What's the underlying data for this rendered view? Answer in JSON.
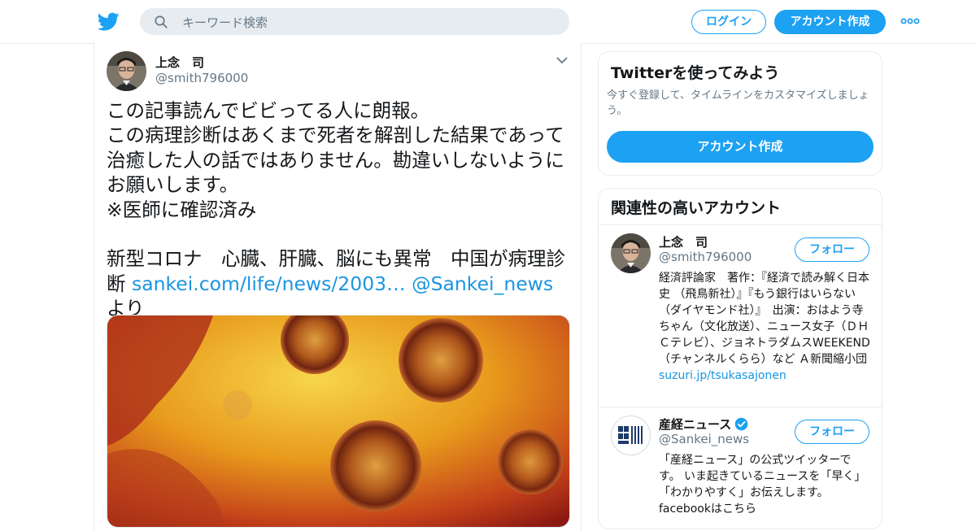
{
  "header": {
    "search_placeholder": "キーワード検索",
    "login_label": "ログイン",
    "signup_label": "アカウント作成",
    "brand_color": "#1da1f2",
    "icons": [
      "twitter-logo-icon",
      "search-icon",
      "more-dots-icon"
    ]
  },
  "tweet": {
    "name": "上念　司",
    "handle": "@smith796000",
    "text_plain": "この記事読んでビビってる人に朗報。\nこの病理診断はあくまで死者を解剖した結果であって治癒した人の話ではありません。勘違いしないようにお願いします。\n※医師に確認済み\n\n新型コロナ　心臓、肝臓、脳にも異常　中国が病理診断 ",
    "link_url": "sankei.com/life/news/2003…",
    "mention": "@Sankei_news",
    "suffix": "より",
    "media_alt": "coronavirus-electron-micrograph"
  },
  "sidebar": {
    "try_card": {
      "title": "Twitterを使ってみよう",
      "description": "今すぐ登録して、タイムラインをカスタマイズしましょう。",
      "button_label": "アカウント作成"
    },
    "related": {
      "title": "関連性の高いアカウント",
      "accounts": [
        {
          "name": "上念　司",
          "handle": "@smith796000",
          "follow_label": "フォロー",
          "bio": "経済評論家　著作：『経済で読み解く日本史 （飛鳥新社）』『もう銀行はいらない（ダイヤモンド社）』　出演：おはよう寺ちゃん（文化放送）、ニュース女子（ＤＨＣテレビ）、ジョネトラダムスWEEKEND（チャンネルくらら）など Ａ新聞縮小団",
          "bio_link": "suzuri.jp/tsukasajonen",
          "verified": false
        },
        {
          "name": "産経ニュース",
          "handle": "@Sankei_news",
          "follow_label": "フォロー",
          "bio": "「産経ニュース」の公式ツイッターです。 いま起きているニュースを「早く」「わかりやすく」お伝えします。facebookはこちら",
          "verified": true,
          "logo_text": "産経新聞 THE SANKEI NEWS"
        }
      ]
    }
  }
}
